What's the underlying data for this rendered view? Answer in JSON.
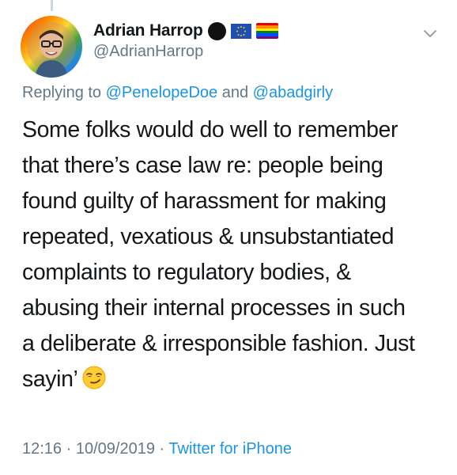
{
  "author": {
    "display_name": "Adrian Harrop",
    "handle": "@AdrianHarrop",
    "name_emojis": [
      "black-circle-icon",
      "eu-flag-icon",
      "rainbow-flag-icon"
    ]
  },
  "reply": {
    "prefix": "Replying to",
    "mention_1": "@PenelopeDoe",
    "joiner": "and",
    "mention_2": "@abadgirly"
  },
  "tweet": {
    "lines": [
      "Some folks would do well to remember",
      "that there’s case law re: people being",
      "found guilty of harassment for making",
      "repeated, vexatious & unsubstantiated",
      "complaints to regulatory bodies, &",
      "abusing their internal processes in such",
      "a deliberate & irresponsible fashion. Just",
      "sayin’"
    ],
    "trailing_emoji": "smirking-face-icon"
  },
  "meta": {
    "time": "12:16",
    "separator": "·",
    "date": "10/09/2019",
    "source": "Twitter for iPhone"
  },
  "colors": {
    "text": "#14171a",
    "secondary": "#657786",
    "link": "#1b95e0"
  }
}
